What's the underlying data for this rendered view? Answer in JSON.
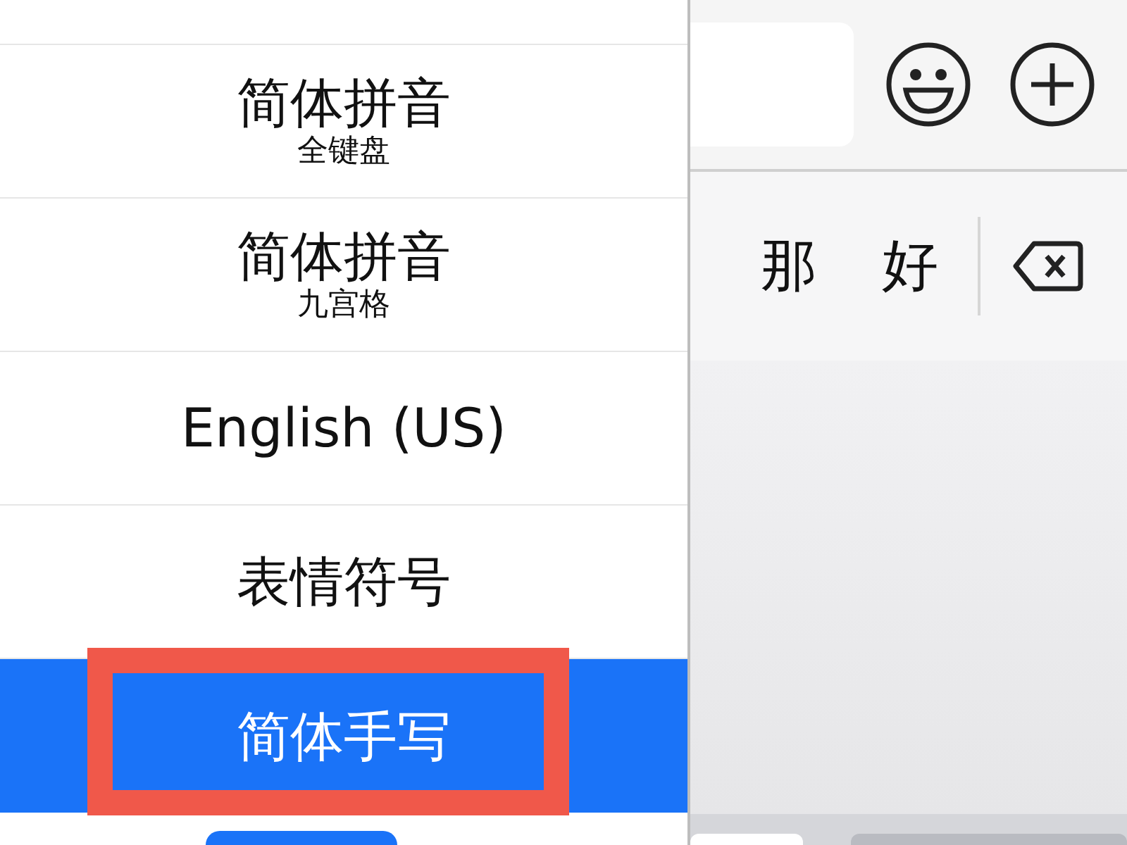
{
  "keyboard_menu": {
    "items": [
      {
        "title": "简体拼音",
        "subtitle": "全键盘",
        "selected": false,
        "highlighted": false
      },
      {
        "title": "简体拼音",
        "subtitle": "九宫格",
        "selected": false,
        "highlighted": false
      },
      {
        "title": "English (US)",
        "selected": false,
        "highlighted": false
      },
      {
        "title": "表情符号",
        "selected": false,
        "highlighted": false
      },
      {
        "title": "简体手写",
        "selected": true,
        "highlighted": true
      }
    ]
  },
  "candidates": [
    "那",
    "好"
  ]
}
